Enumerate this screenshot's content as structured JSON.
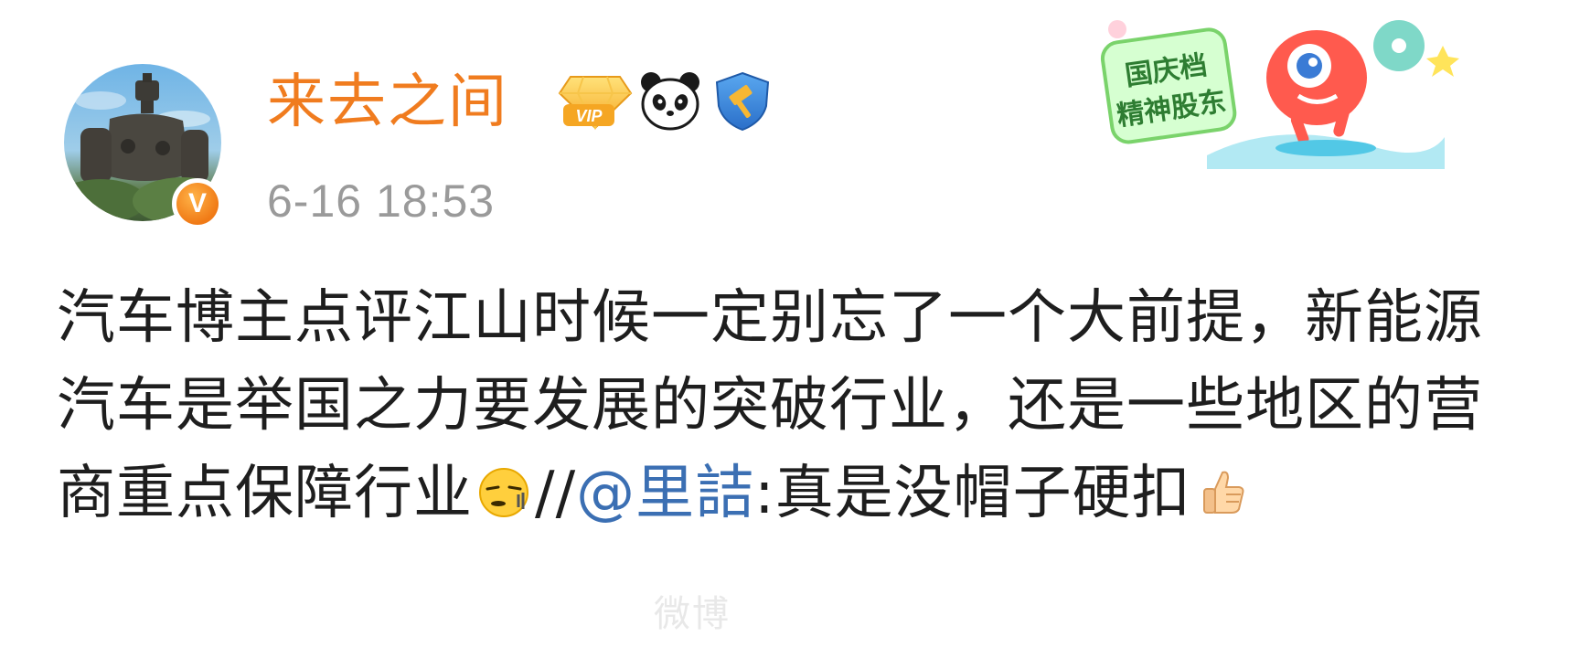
{
  "post": {
    "author": {
      "name": "来去之间",
      "badges": [
        "vip-diamond-badge",
        "panda-badge",
        "gov-hammer-badge"
      ],
      "verified_mark": "V"
    },
    "timestamp": "6-16 18:53",
    "body": {
      "part1": "汽车博主点评江山时候一定别忘了一个大前提，新能源汽车是举国之力要发展的突破行业，还是一些地区的营商重点保障行业",
      "emoji1": "squinting-face-emoji",
      "repost_prefix": "//",
      "mention": "@里詰",
      "colon": ":",
      "part2": "真是没帽子硬扣",
      "emoji2": "thumbs-up-emoji"
    },
    "promo": {
      "line1": "国庆档",
      "line2": "精神股东"
    },
    "watermark": "微博"
  },
  "colors": {
    "username": "#f07c1f",
    "timestamp": "#9a9a9a",
    "text": "#1e1e1e",
    "mention": "#3b6fb3",
    "promo_text": "#3a8a3e"
  }
}
